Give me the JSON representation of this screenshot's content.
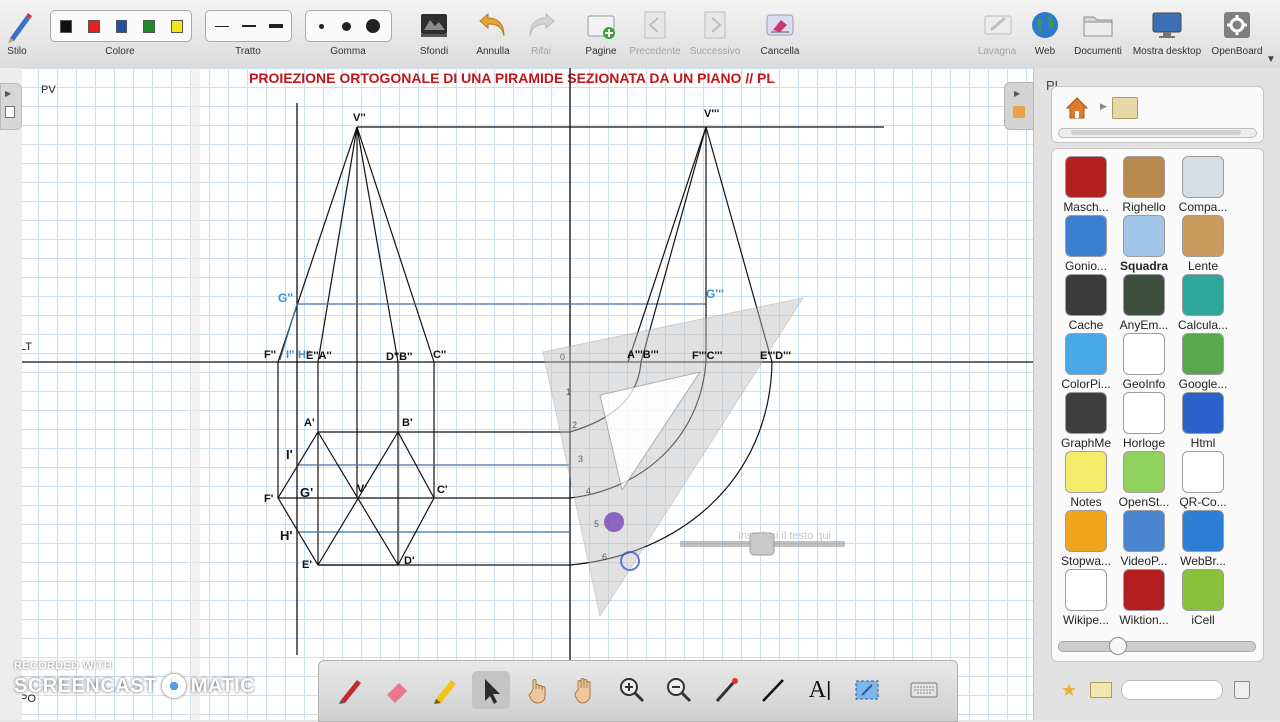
{
  "toolbar": {
    "stilo_label": "Stilo",
    "colore_label": "Colore",
    "tratto_label": "Tratto",
    "gomma_label": "Gomma",
    "sfondi_label": "Sfondi",
    "annulla_label": "Annulla",
    "rifai_label": "Rifai",
    "pagine_label": "Pagine",
    "precedente_label": "Precedente",
    "successivo_label": "Successivo",
    "cancella_label": "Cancella",
    "lavagna_label": "Lavagna",
    "web_label": "Web",
    "documenti_label": "Documenti",
    "mostra_desktop_label": "Mostra desktop",
    "openboard_label": "OpenBoard",
    "colors": [
      "#111111",
      "#e8201c",
      "#1f4fa8",
      "#1f8a2a",
      "#f6e41c"
    ]
  },
  "board": {
    "title": "PROIEZIONE ORTOGONALE DI UNA PIRAMIDE SEZIONATA DA UN PIANO // PL",
    "title_color": "#c0161b",
    "pv_label": "PV",
    "lt_label": "LT",
    "ph_label": "PO",
    "text_placeholder": "Inserisci il testo qui",
    "labels": {
      "v2": "V''",
      "v3": "V'''",
      "g2": "G''",
      "g3": "G'''",
      "f2": "F''",
      "i2": "I''",
      "h2": "H''",
      "ea2": "E''A''",
      "db2": "D''B''",
      "c2": "C''",
      "ab3": "A'''B'''",
      "fc3": "F'''C'''",
      "ed3": "E'''D'''",
      "a1": "A'",
      "b1": "B'",
      "i1": "I'",
      "g1": "G'",
      "v1": "V'",
      "c1": "C'",
      "f1": "F'",
      "h1": "H'",
      "e1": "E'",
      "d1": "D'"
    },
    "ruler_numbers": [
      "0",
      "1",
      "2",
      "3",
      "4",
      "5",
      "6"
    ]
  },
  "panel": {
    "header": "PL",
    "apps": [
      {
        "label": "Masch...",
        "color": "#b32020",
        "icon": "mask-icon"
      },
      {
        "label": "Righello",
        "color": "#b98a4d",
        "icon": "ruler-icon"
      },
      {
        "label": "Compa...",
        "color": "#d7dde4",
        "icon": "compass-icon"
      },
      {
        "label": "Gonio...",
        "color": "#3a7fd0",
        "icon": "protractor-icon"
      },
      {
        "label": "Squadra",
        "color": "#9fc6e8",
        "icon": "set-square-icon",
        "selected": true
      },
      {
        "label": "Lente",
        "color": "#c99b5c",
        "icon": "magnifier-icon"
      },
      {
        "label": "Cache",
        "color": "#3a3a3a",
        "icon": "cache-icon"
      },
      {
        "label": "AnyEm...",
        "color": "#3f4f3f",
        "icon": "film-icon"
      },
      {
        "label": "Calcula...",
        "color": "#2fa69b",
        "icon": "calculator-icon"
      },
      {
        "label": "ColorPi...",
        "color": "#48a8e8",
        "icon": "color-picker-icon"
      },
      {
        "label": "GeoInfo",
        "color": "#ffffff",
        "icon": "world-map-icon"
      },
      {
        "label": "Google...",
        "color": "#59a84f",
        "icon": "google-maps-icon"
      },
      {
        "label": "GraphMe",
        "color": "#3d3d3d",
        "icon": "graph-icon"
      },
      {
        "label": "Horloge",
        "color": "#ffffff",
        "icon": "clock-icon"
      },
      {
        "label": "Html",
        "color": "#2b62c9",
        "icon": "html-icon"
      },
      {
        "label": "Notes",
        "color": "#f6eb6a",
        "icon": "notes-icon"
      },
      {
        "label": "OpenSt...",
        "color": "#8fd15a",
        "icon": "search-icon"
      },
      {
        "label": "QR-Co...",
        "color": "#ffffff",
        "icon": "qr-code-icon"
      },
      {
        "label": "Stopwa...",
        "color": "#f0a51c",
        "icon": "stopwatch-icon"
      },
      {
        "label": "VideoP...",
        "color": "#4a86cf",
        "icon": "video-player-icon"
      },
      {
        "label": "WebBr...",
        "color": "#2c7fd4",
        "icon": "web-browser-icon"
      },
      {
        "label": "Wikipe...",
        "color": "#ffffff",
        "icon": "wikipedia-icon"
      },
      {
        "label": "Wiktion...",
        "color": "#b31e1e",
        "icon": "wiktionary-icon"
      },
      {
        "label": "iCell",
        "color": "#8ac13a",
        "icon": "icell-icon"
      }
    ]
  },
  "bottom_toolbar": {
    "text_tool_label": "A",
    "tools": [
      "pen-icon",
      "eraser-icon",
      "marker-icon",
      "pointer-icon",
      "interact-icon",
      "hand-icon",
      "zoom-in-icon",
      "zoom-out-icon",
      "laser-icon",
      "line-icon",
      "text-icon",
      "capture-icon",
      "keyboard-icon"
    ],
    "selected": "pointer-icon"
  },
  "watermark": {
    "line1": "RECORDED WITH",
    "line2a": "SCREENCAST",
    "line2b": "MATIC"
  }
}
